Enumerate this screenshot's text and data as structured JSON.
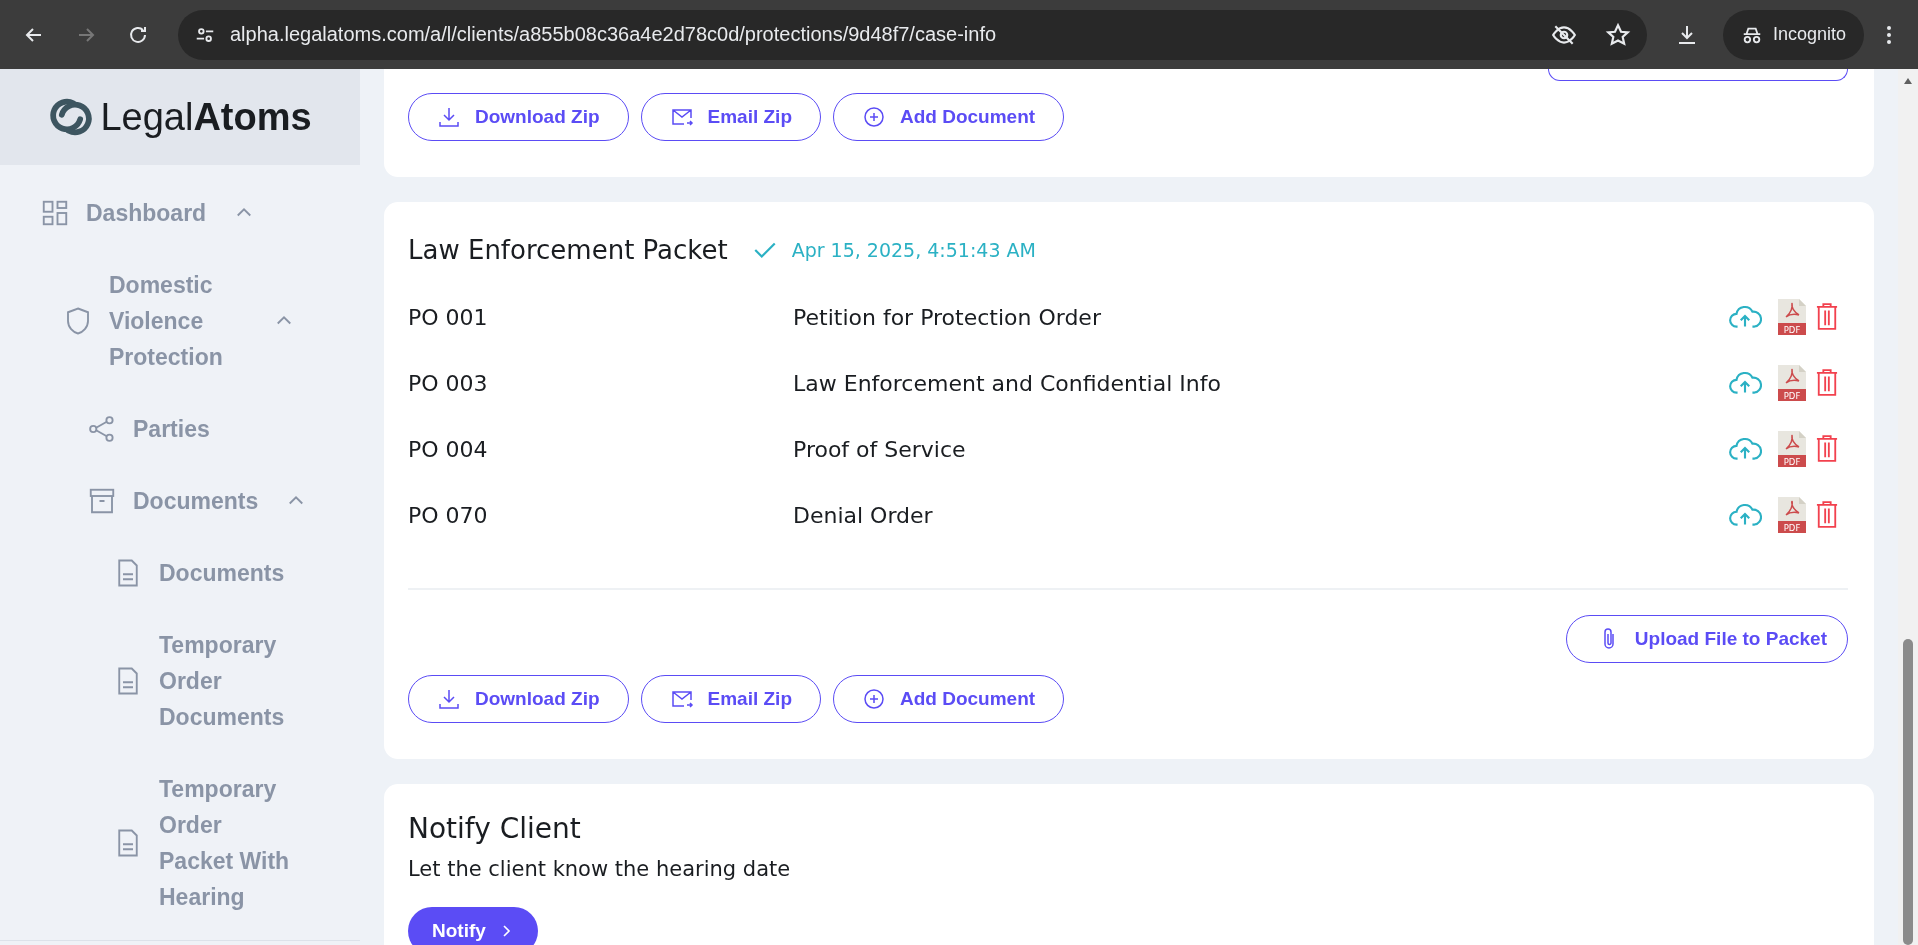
{
  "browser": {
    "url": "alpha.legalatoms.com/a/l/clients/a855b08c36a4e2d78c0d/protections/9d48f7/case-info",
    "profile": "Incognito"
  },
  "sidebar": {
    "logo": "Legal**Atoms**",
    "items": [
      {
        "label": "Dashboard",
        "kind": "grid",
        "expanded": true,
        "children": [
          {
            "label": "Domestic Violence Protection",
            "kind": "shield",
            "expanded": true,
            "children": [
              {
                "label": "Parties",
                "kind": "share"
              },
              {
                "label": "Documents",
                "kind": "archive",
                "expanded": true,
                "children": [
                  {
                    "label": "Documents",
                    "kind": "file"
                  },
                  {
                    "label": "Temporary Order Documents",
                    "kind": "file"
                  },
                  {
                    "label": "Temporary Order Packet With Hearing",
                    "kind": "file"
                  }
                ]
              }
            ]
          }
        ]
      }
    ]
  },
  "top_card": {
    "actions": [
      {
        "label": "Download Zip",
        "kind": "download"
      },
      {
        "label": "Email Zip",
        "kind": "email"
      },
      {
        "label": "Add Document",
        "kind": "add"
      }
    ]
  },
  "packet": {
    "title": "Law Enforcement Packet",
    "timestamp": "Apr 15, 2025, 4:51:43 AM",
    "documents": [
      {
        "code": "PO 001",
        "name": "Petition for Protection Order",
        "file_badge": "PDF"
      },
      {
        "code": "PO 003",
        "name": "Law Enforcement and Confidential Info",
        "file_badge": "PDF"
      },
      {
        "code": "PO 004",
        "name": "Proof of Service",
        "file_badge": "PDF"
      },
      {
        "code": "PO 070",
        "name": "Denial Order",
        "file_badge": "PDF"
      }
    ],
    "upload_button": "Upload File to Packet",
    "actions": [
      {
        "label": "Download Zip",
        "kind": "download"
      },
      {
        "label": "Email Zip",
        "kind": "email"
      },
      {
        "label": "Add Document",
        "kind": "add"
      }
    ]
  },
  "notify": {
    "title": "Notify Client",
    "description": "Let the client know the hearing date",
    "button": "Notify"
  }
}
